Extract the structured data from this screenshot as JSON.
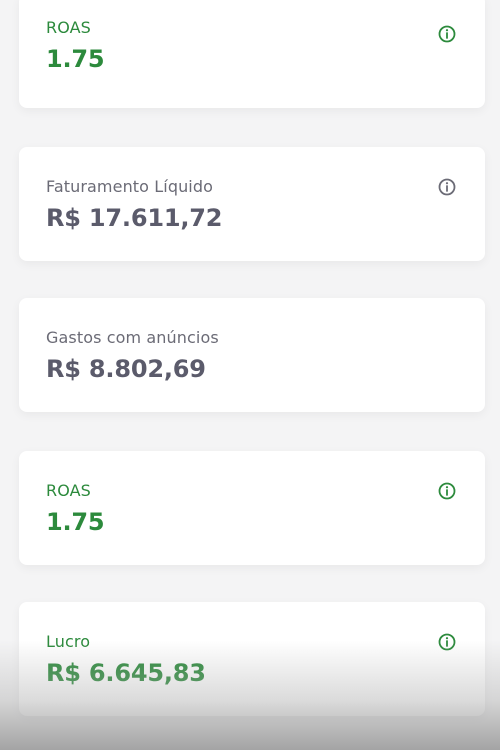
{
  "colors": {
    "accent_green": "#2c8a3c",
    "gray_text": "#6b6b76",
    "card_bg": "#ffffff",
    "page_bg": "#f4f4f5"
  },
  "cards": [
    {
      "label": "ROAS",
      "value": "1.75",
      "style": "green",
      "icon": "info-icon"
    },
    {
      "label": "Faturamento Líquido",
      "value": "R$ 17.611,72",
      "style": "gray",
      "icon": "info-icon"
    },
    {
      "label": "Gastos com anúncios",
      "value": "R$ 8.802,69",
      "style": "gray"
    },
    {
      "label": "ROAS",
      "value": "1.75",
      "style": "green",
      "icon": "info-icon"
    },
    {
      "label": "Lucro",
      "value": "R$ 6.645,83",
      "style": "green",
      "icon": "info-icon"
    }
  ]
}
